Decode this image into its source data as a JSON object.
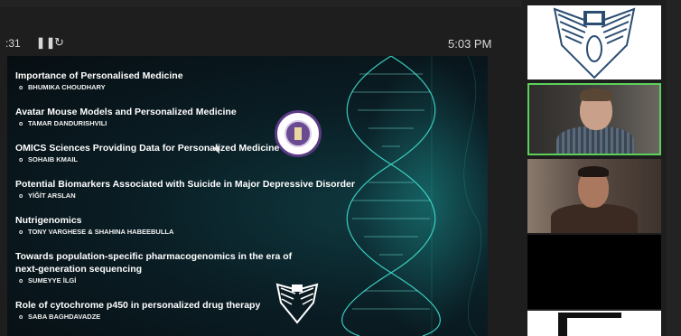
{
  "controls": {
    "elapsed": ":31",
    "pause_icon": "pause-icon",
    "reload_icon": "reload-icon",
    "clock": "5:03 PM"
  },
  "slide": {
    "items": [
      {
        "title": "Importance of Personalised Medicine",
        "author": "BHUMIKA CHOUDHARY"
      },
      {
        "title": "Avatar Mouse Models and Personalized Medicine",
        "author": "TAMAR DANDURISHVILI"
      },
      {
        "title": "OMICS Sciences Providing Data for Personalized Medicine",
        "author": "SOHAIB KMAIL"
      },
      {
        "title": "Potential Biomarkers Associated with Suicide in Major Depressive Disorder",
        "author": "YİĞİT ARSLAN"
      },
      {
        "title": "Nutrigenomics",
        "author": "TONY VARGHESE & SHAHINA HABEEBULLA"
      },
      {
        "title": "Towards population-specific pharmacogenomics in the era of next-generation sequencing",
        "author": "SUMEYYE İLGİ"
      },
      {
        "title": "Role of cytochrome p450 in personalized drug therapy",
        "author": "SABA BAGHDAVADZE"
      }
    ],
    "bullet": "o"
  },
  "colors": {
    "active_speaker_border": "#5bd15a",
    "slide_bg": "#0a1e25",
    "helix": "#3fe0d0"
  }
}
